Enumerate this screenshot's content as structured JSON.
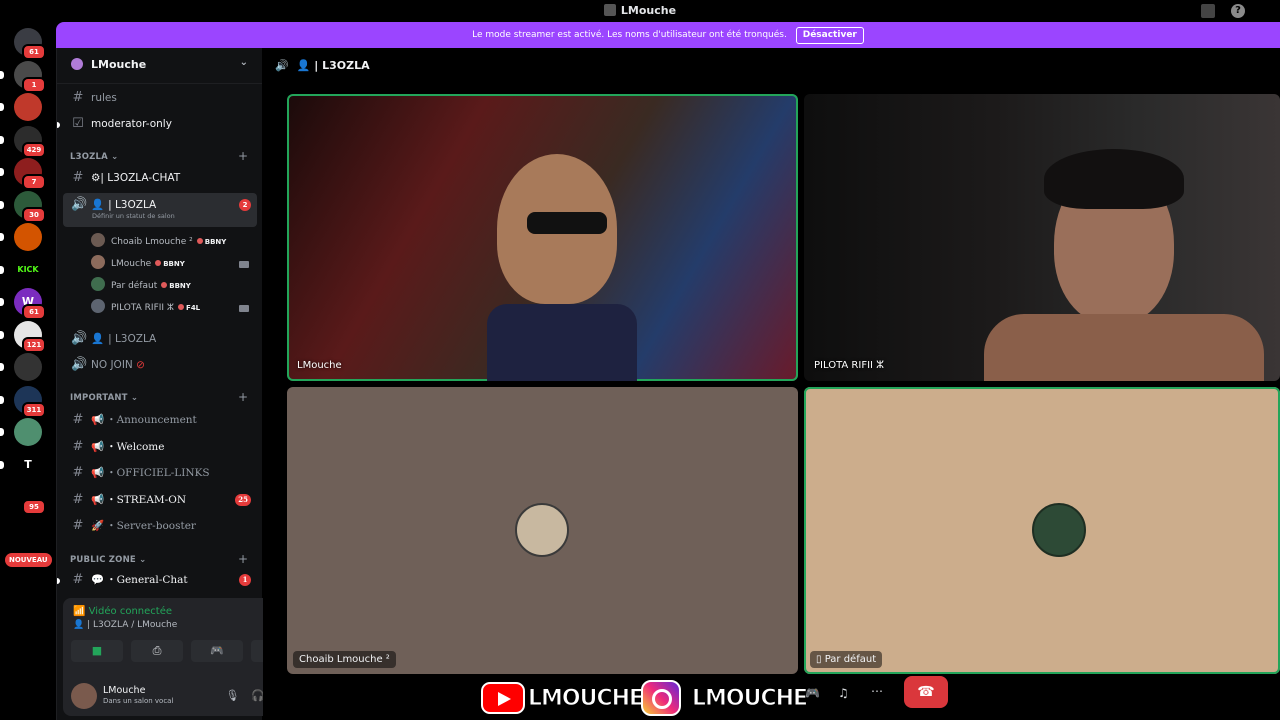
{
  "window": {
    "title": "LMouche"
  },
  "banner": {
    "text": "Le mode streamer est activé. Les noms d'utilisateur ont été tronqués.",
    "button": "Désactiver"
  },
  "guilds": [
    {
      "badge": "61",
      "color": "#3a3c43",
      "icon": "discord-icon"
    },
    {
      "badge": "1",
      "color": "#4a4a4a",
      "icon": "server-icon"
    },
    {
      "badge": "",
      "color": "#c0392b",
      "icon": "server-icon"
    },
    {
      "badge": "429",
      "color": "#2c2c2c",
      "icon": "server-icon"
    },
    {
      "badge": "7",
      "color": "#8e1e1e",
      "icon": "server-icon"
    },
    {
      "badge": "30",
      "color": "#2c5a3a",
      "icon": "server-icon"
    },
    {
      "badge": "",
      "color": "#d35400",
      "icon": "server-icon"
    },
    {
      "badge": "",
      "color": "#000000",
      "icon": "kick-icon",
      "text": "KICK"
    },
    {
      "badge": "61",
      "color": "#7b2cbf",
      "icon": "server-icon",
      "text": "W"
    },
    {
      "badge": "121",
      "color": "#e5e5e5",
      "icon": "server-icon"
    },
    {
      "badge": "",
      "color": "#333333",
      "icon": "server-icon"
    },
    {
      "badge": "311",
      "color": "#1d3557",
      "icon": "server-icon"
    },
    {
      "badge": "",
      "color": "#4f8f6f",
      "icon": "server-icon"
    },
    {
      "badge": "",
      "color": "#000000",
      "icon": "server-icon",
      "text": "T"
    },
    {
      "badge": "95",
      "color": "#000000",
      "icon": "server-icon"
    }
  ],
  "guild_new_label": "NOUVEAU",
  "sidebar": {
    "server_name": "LMouche",
    "channels_top": [
      {
        "name": "rules",
        "type": "text"
      },
      {
        "name": "moderator-only",
        "type": "check"
      }
    ],
    "category1": "L3OZLA",
    "category1_channels": [
      {
        "name": "⚙| L3OZLA-CHAT"
      }
    ],
    "active_voice": {
      "name": "| L3OZLA",
      "badge": "2",
      "status": "Définir un statut de salon"
    },
    "voice_users": [
      {
        "name": "Choaib Lmouche ²",
        "tag": "BBNY",
        "avatar": "#6b5a52",
        "cam": false
      },
      {
        "name": "LMouche",
        "tag": "BBNY",
        "avatar": "#8c6b5c",
        "cam": true
      },
      {
        "name": "Par défaut",
        "tag": "BBNY",
        "avatar": "#3f6d4e",
        "cam": false
      },
      {
        "name": "PILOTA RIFII ⵣ",
        "tag": "F4L",
        "avatar": "#5d6470",
        "cam": true
      }
    ],
    "voice2": "| L3OZLA",
    "voice3": "NO JOIN",
    "category2": "IMPORTANT",
    "category2_channels": [
      {
        "name": "・Announcement",
        "bright": false,
        "badge": ""
      },
      {
        "name": "・Welcome",
        "bright": true,
        "badge": ""
      },
      {
        "name": "・OFFICIEL-LINKS",
        "bright": false,
        "badge": ""
      },
      {
        "name": "・STREAM-ON",
        "bright": true,
        "badge": "25"
      },
      {
        "name": "・Server-booster",
        "bright": false,
        "badge": ""
      }
    ],
    "category3": "PUBLIC ZONE",
    "category3_channels": [
      {
        "name": "・General-Chat",
        "bright": true,
        "badge": "1"
      }
    ]
  },
  "voice_panel": {
    "status": "Vidéo connectée",
    "location": "| L3OZLA / LMouche",
    "user_name": "LMouche",
    "user_status": "Dans un salon vocal"
  },
  "main": {
    "header": "| L3OZLA",
    "tiles": [
      {
        "label": "LMouche"
      },
      {
        "label": "PILOTA RIFII ⵣ"
      },
      {
        "label": "Choaib Lmouche ²"
      },
      {
        "label": "Par défaut"
      }
    ]
  },
  "overlay": {
    "youtube": "LMOUCHE",
    "instagram": "LMOUCHE"
  },
  "colors": {
    "accent": "#9b45ff",
    "speaking": "#23a55a",
    "danger": "#da373c"
  }
}
